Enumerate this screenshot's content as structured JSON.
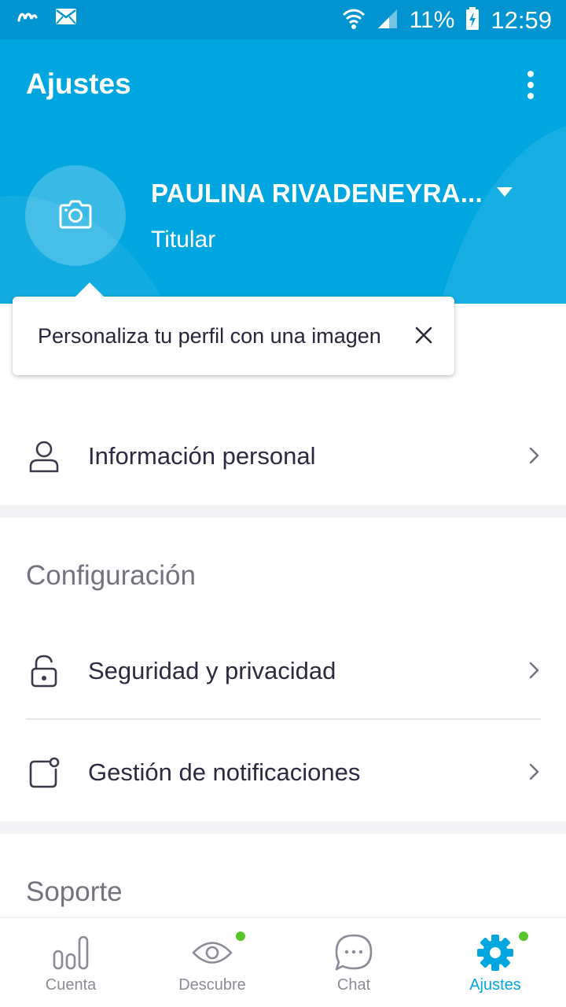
{
  "status_bar": {
    "battery": "11%",
    "time": "12:59",
    "icons": [
      "carrier-logo-icon",
      "mail-icon",
      "wifi-icon",
      "signal-icon",
      "battery-charging-icon"
    ]
  },
  "header": {
    "title": "Ajustes",
    "background_color": "#00a6df",
    "more_icon": "more-vert-icon"
  },
  "profile": {
    "name": "PAULINA RIVADENEYRA...",
    "role": "Titular",
    "avatar_icon": "camera-icon",
    "dropdown_icon": "caret-down-icon"
  },
  "tooltip": {
    "text": "Personaliza tu perfil con una imagen",
    "close_icon": "close-icon"
  },
  "personal": {
    "label": "Información personal",
    "icon": "user-icon"
  },
  "configuracion": {
    "title": "Configuración",
    "items": [
      {
        "label": "Seguridad y privacidad",
        "icon": "lock-icon"
      },
      {
        "label": "Gestión de notificaciones",
        "icon": "notification-icon"
      }
    ]
  },
  "soporte": {
    "title": "Soporte"
  },
  "bottom_nav": {
    "active_color": "#00a6df",
    "badge_color": "#5ac52b",
    "items": [
      {
        "label": "Cuenta",
        "icon": "bar-chart-icon",
        "active": false,
        "badge": false
      },
      {
        "label": "Descubre",
        "icon": "eye-icon",
        "active": false,
        "badge": true
      },
      {
        "label": "Chat",
        "icon": "chat-bubble-icon",
        "active": false,
        "badge": false
      },
      {
        "label": "Ajustes",
        "icon": "gear-icon",
        "active": true,
        "badge": true
      }
    ]
  }
}
